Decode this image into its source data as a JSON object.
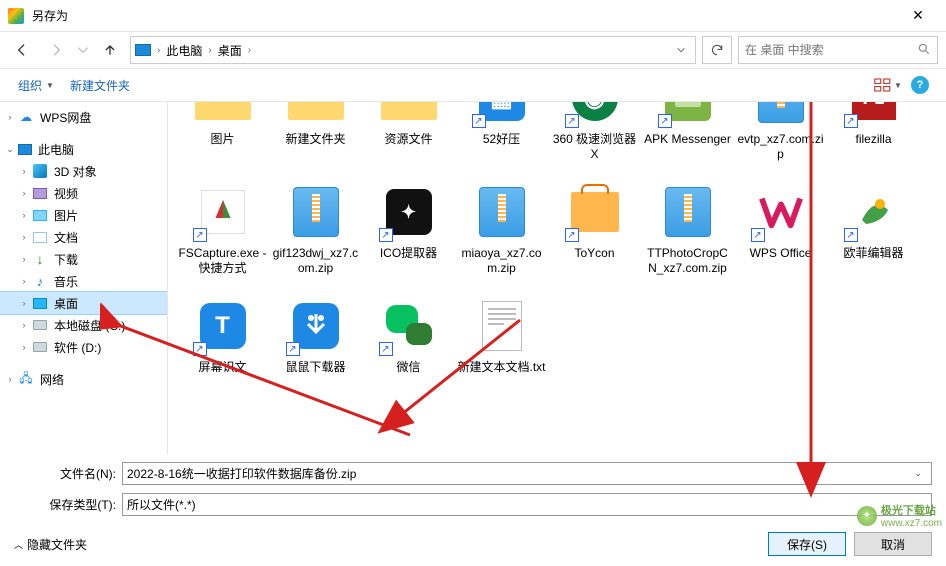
{
  "window": {
    "title": "另存为",
    "close_icon": "close"
  },
  "nav": {
    "crumbs": [
      "此电脑",
      "桌面"
    ],
    "search_placeholder": "在 桌面 中搜索"
  },
  "toolbar": {
    "organize": "组织",
    "new_folder": "新建文件夹"
  },
  "tree": {
    "wps": "WPS网盘",
    "this_pc": "此电脑",
    "items": [
      "3D 对象",
      "视频",
      "图片",
      "文档",
      "下载",
      "音乐",
      "桌面",
      "本地磁盘 (C:)",
      "软件 (D:)"
    ],
    "network": "网络"
  },
  "files_row1": [
    {
      "name": "图片",
      "kind": "folder"
    },
    {
      "name": "新建文件夹",
      "kind": "folder"
    },
    {
      "name": "资源文件",
      "kind": "folder"
    },
    {
      "name": "52好压",
      "kind": "app-blue"
    },
    {
      "name": "360 极速浏览器X",
      "kind": "app-green"
    },
    {
      "name": "APK Messenger",
      "kind": "apk"
    },
    {
      "name": "evtp_xz7.com.zip",
      "kind": "zip"
    },
    {
      "name": "filezilla",
      "kind": "filezilla"
    }
  ],
  "files_row2": [
    {
      "name": "FSCapture.exe - 快捷方式",
      "kind": "fscapture"
    },
    {
      "name": "gif123dwj_xz7.com.zip",
      "kind": "zip"
    },
    {
      "name": "ICO提取器",
      "kind": "app-dark"
    },
    {
      "name": "miaoya_xz7.com.zip",
      "kind": "zip"
    },
    {
      "name": "ToYcon",
      "kind": "toycon"
    },
    {
      "name": "TTPhotoCropCN_xz7.com.zip",
      "kind": "zip"
    },
    {
      "name": "WPS Office",
      "kind": "wps"
    },
    {
      "name": "欧菲编辑器",
      "kind": "oufei"
    }
  ],
  "files_row3": [
    {
      "name": "屏幕识文",
      "kind": "screen-t"
    },
    {
      "name": "鼠鼠下载器",
      "kind": "mouse-dl"
    },
    {
      "name": "微信",
      "kind": "wechat"
    },
    {
      "name": "新建文本文档.txt",
      "kind": "txt"
    }
  ],
  "form": {
    "filename_label": "文件名(N):",
    "filename_value": "2022-8-16统一收据打印软件数据库备份.zip",
    "type_label": "保存类型(T):",
    "type_value": "所以文件(*.*)"
  },
  "footer": {
    "hide_folders": "隐藏文件夹",
    "save": "保存(S)",
    "cancel": "取消"
  },
  "watermark": {
    "site": "极光下载站",
    "url": "www.xz7.com"
  }
}
